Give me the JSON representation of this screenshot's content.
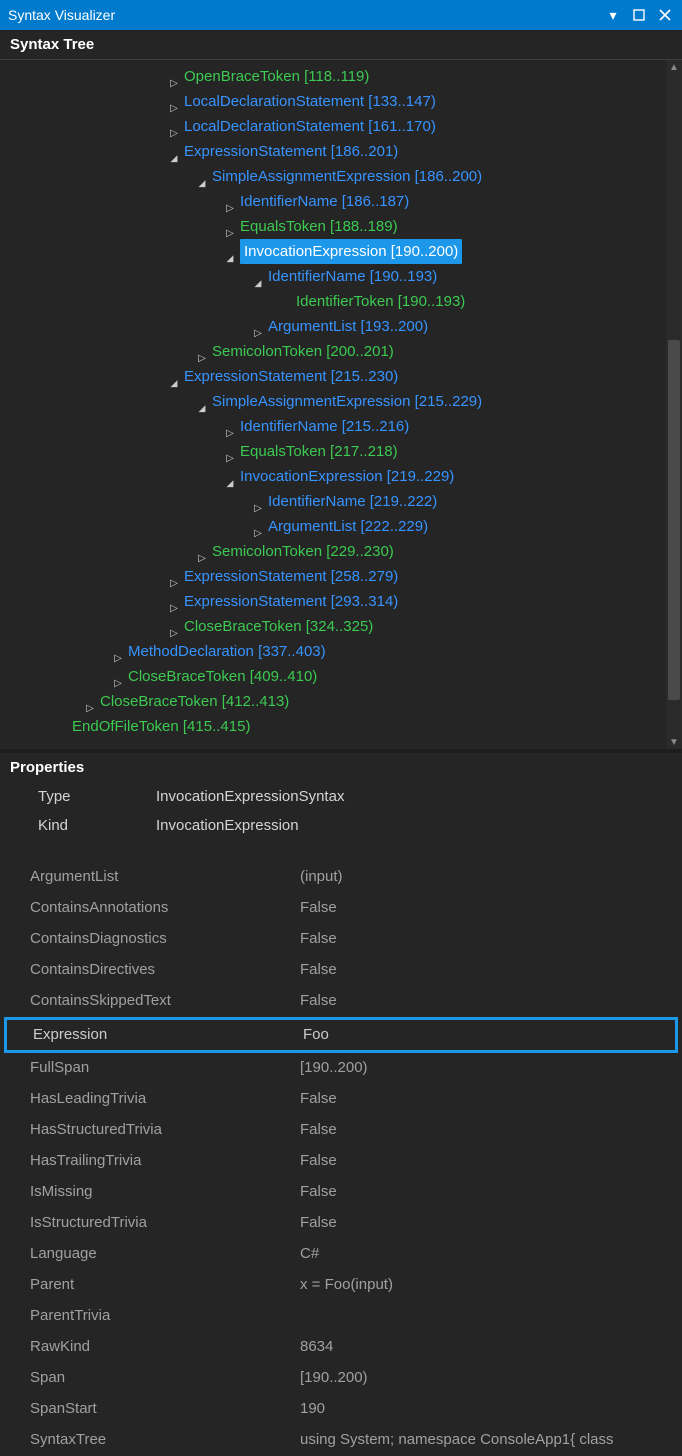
{
  "titlebar": {
    "title": "Syntax Visualizer"
  },
  "sections": {
    "tree": "Syntax Tree",
    "properties": "Properties"
  },
  "summary": {
    "typeLabel": "Type",
    "typeValue": "InvocationExpressionSyntax",
    "kindLabel": "Kind",
    "kindValue": "InvocationExpression"
  },
  "tree": [
    {
      "indent": 6,
      "tw": "collapsed",
      "cls": "green",
      "text": "OpenBraceToken [118..119)"
    },
    {
      "indent": 6,
      "tw": "collapsed",
      "cls": "blue",
      "text": "LocalDeclarationStatement [133..147)"
    },
    {
      "indent": 6,
      "tw": "collapsed",
      "cls": "blue",
      "text": "LocalDeclarationStatement [161..170)"
    },
    {
      "indent": 6,
      "tw": "expanded",
      "cls": "blue",
      "text": "ExpressionStatement [186..201)"
    },
    {
      "indent": 7,
      "tw": "expanded",
      "cls": "blue",
      "text": "SimpleAssignmentExpression [186..200)"
    },
    {
      "indent": 8,
      "tw": "collapsed",
      "cls": "blue",
      "text": "IdentifierName [186..187)"
    },
    {
      "indent": 8,
      "tw": "collapsed",
      "cls": "green",
      "text": "EqualsToken [188..189)"
    },
    {
      "indent": 8,
      "tw": "expanded",
      "cls": "blue",
      "text": "InvocationExpression [190..200)",
      "selected": true
    },
    {
      "indent": 9,
      "tw": "expanded",
      "cls": "blue",
      "text": "IdentifierName [190..193)"
    },
    {
      "indent": 10,
      "tw": "",
      "cls": "green",
      "text": "IdentifierToken [190..193)"
    },
    {
      "indent": 9,
      "tw": "collapsed",
      "cls": "blue",
      "text": "ArgumentList [193..200)"
    },
    {
      "indent": 7,
      "tw": "collapsed",
      "cls": "green",
      "text": "SemicolonToken [200..201)"
    },
    {
      "indent": 6,
      "tw": "expanded",
      "cls": "blue",
      "text": "ExpressionStatement [215..230)"
    },
    {
      "indent": 7,
      "tw": "expanded",
      "cls": "blue",
      "text": "SimpleAssignmentExpression [215..229)"
    },
    {
      "indent": 8,
      "tw": "collapsed",
      "cls": "blue",
      "text": "IdentifierName [215..216)"
    },
    {
      "indent": 8,
      "tw": "collapsed",
      "cls": "green",
      "text": "EqualsToken [217..218)"
    },
    {
      "indent": 8,
      "tw": "expanded",
      "cls": "blue",
      "text": "InvocationExpression [219..229)"
    },
    {
      "indent": 9,
      "tw": "collapsed",
      "cls": "blue",
      "text": "IdentifierName [219..222)"
    },
    {
      "indent": 9,
      "tw": "collapsed",
      "cls": "blue",
      "text": "ArgumentList [222..229)"
    },
    {
      "indent": 7,
      "tw": "collapsed",
      "cls": "green",
      "text": "SemicolonToken [229..230)"
    },
    {
      "indent": 6,
      "tw": "collapsed",
      "cls": "blue",
      "text": "ExpressionStatement [258..279)"
    },
    {
      "indent": 6,
      "tw": "collapsed",
      "cls": "blue",
      "text": "ExpressionStatement [293..314)"
    },
    {
      "indent": 6,
      "tw": "collapsed",
      "cls": "green",
      "text": "CloseBraceToken [324..325)"
    },
    {
      "indent": 4,
      "tw": "collapsed",
      "cls": "blue",
      "text": "MethodDeclaration [337..403)"
    },
    {
      "indent": 4,
      "tw": "collapsed",
      "cls": "green",
      "text": "CloseBraceToken [409..410)"
    },
    {
      "indent": 3,
      "tw": "collapsed",
      "cls": "green",
      "text": "CloseBraceToken [412..413)"
    },
    {
      "indent": 2,
      "tw": "",
      "cls": "green",
      "text": "EndOfFileToken [415..415)"
    }
  ],
  "props": [
    {
      "n": "ArgumentList",
      "v": "(input)"
    },
    {
      "n": "ContainsAnnotations",
      "v": "False"
    },
    {
      "n": "ContainsDiagnostics",
      "v": "False"
    },
    {
      "n": "ContainsDirectives",
      "v": "False"
    },
    {
      "n": "ContainsSkippedText",
      "v": "False"
    },
    {
      "n": "Expression",
      "v": "Foo",
      "hl": true
    },
    {
      "n": "FullSpan",
      "v": "[190..200)"
    },
    {
      "n": "HasLeadingTrivia",
      "v": "False"
    },
    {
      "n": "HasStructuredTrivia",
      "v": "False"
    },
    {
      "n": "HasTrailingTrivia",
      "v": "False"
    },
    {
      "n": "IsMissing",
      "v": "False"
    },
    {
      "n": "IsStructuredTrivia",
      "v": "False"
    },
    {
      "n": "Language",
      "v": "C#"
    },
    {
      "n": "Parent",
      "v": "x = Foo(input)"
    },
    {
      "n": "ParentTrivia",
      "v": ""
    },
    {
      "n": "RawKind",
      "v": "8634"
    },
    {
      "n": "Span",
      "v": "[190..200)"
    },
    {
      "n": "SpanStart",
      "v": "190"
    },
    {
      "n": "SyntaxTree",
      "v": "using System; namespace ConsoleApp1{     class"
    }
  ]
}
